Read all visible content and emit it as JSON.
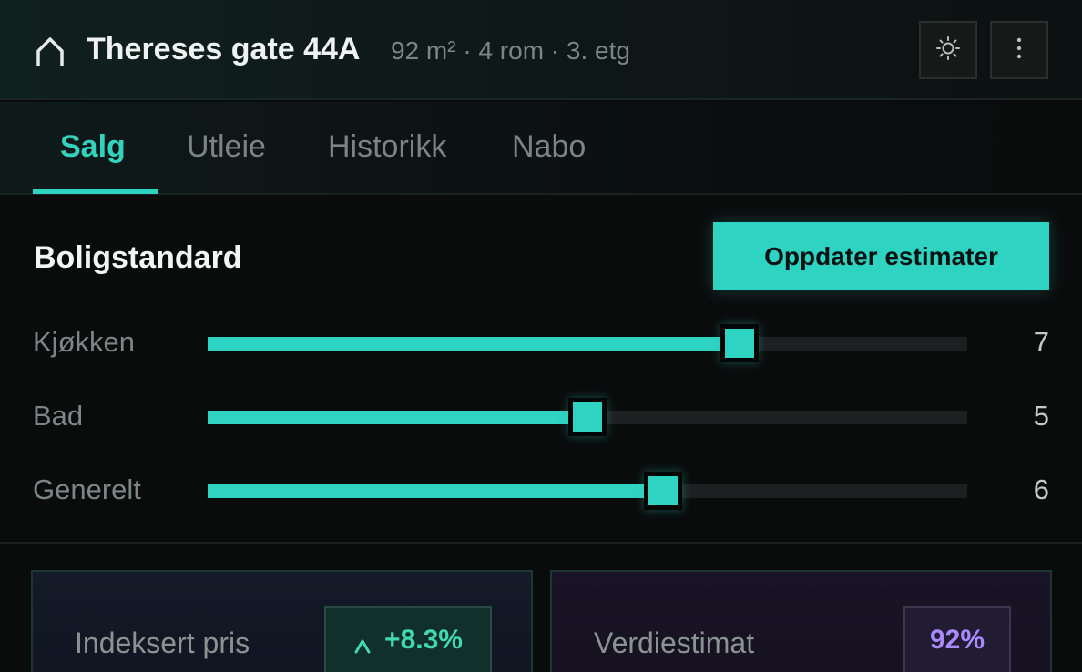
{
  "header": {
    "title": "Thereses gate 44A",
    "meta": "92 m² · 4 rom · 3. etg",
    "icons": {
      "home": "home-icon",
      "theme": "sun-icon",
      "more": "more-vertical-icon"
    }
  },
  "tabs": [
    {
      "label": "Salg",
      "active": true
    },
    {
      "label": "Utleie",
      "active": false
    },
    {
      "label": "Historikk",
      "active": false
    },
    {
      "label": "Nabo",
      "active": false
    }
  ],
  "section": {
    "title": "Boligstandard",
    "update_button": "Oppdater estimater"
  },
  "sliders": [
    {
      "label": "Kjøkken",
      "value": "7",
      "fraction": 0.7
    },
    {
      "label": "Bad",
      "value": "5",
      "fraction": 0.5
    },
    {
      "label": "Generelt",
      "value": "6",
      "fraction": 0.6
    }
  ],
  "cards": [
    {
      "label": "Indeksert pris",
      "badge": "+8.3%",
      "badge_icon": "caret-up-icon"
    },
    {
      "label": "Verdiestimat",
      "badge": "92%"
    }
  ],
  "colors": {
    "accent": "#2ed3c1",
    "positive": "#42d8b2",
    "purple": "#a98bff",
    "background": "#0a0c0c"
  }
}
